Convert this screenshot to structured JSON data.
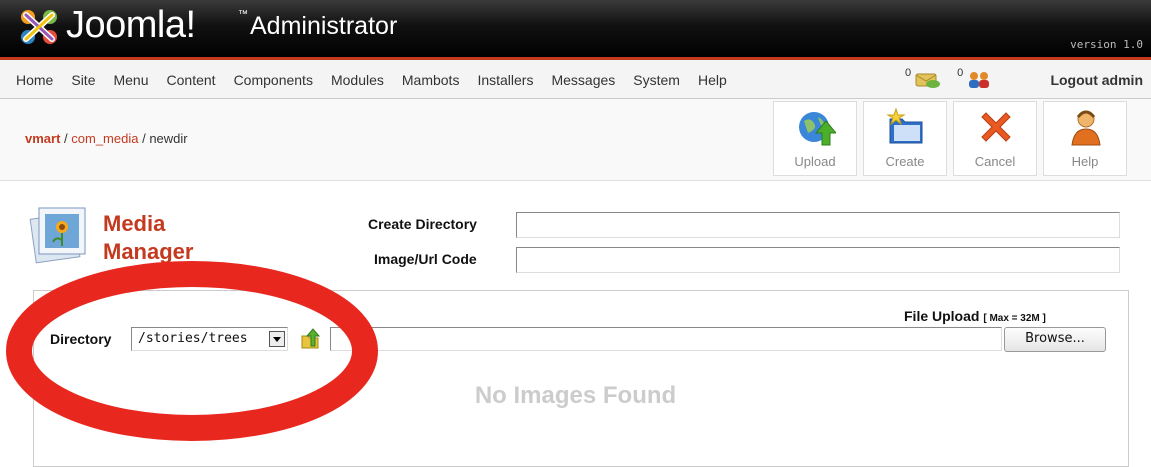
{
  "header": {
    "brand": "Joomla!",
    "tm": "™",
    "subtitle": "Administrator",
    "version": "version 1.0"
  },
  "menu": {
    "items": [
      "Home",
      "Site",
      "Menu",
      "Content",
      "Components",
      "Modules",
      "Mambots",
      "Installers",
      "Messages",
      "System",
      "Help"
    ],
    "messages_count": "0",
    "users_count": "0",
    "logout": "Logout admin"
  },
  "breadcrumb": {
    "root": "vmart",
    "sep1": " / ",
    "component": "com_media",
    "sep2": " / ",
    "current": "newdir"
  },
  "toolbar": {
    "upload": "Upload",
    "create": "Create",
    "cancel": "Cancel",
    "help": "Help"
  },
  "page": {
    "title_line1": "Media",
    "title_line2": "Manager",
    "create_dir_label": "Create Directory",
    "create_dir_value": "",
    "image_url_label": "Image/Url Code",
    "image_url_value": ""
  },
  "browser": {
    "directory_label": "Directory",
    "directory_value": "/stories/trees",
    "file_upload_label": "File Upload",
    "max_label": "[ Max = 32M ]",
    "browse_label": "Browse...",
    "empty_message": "No Images Found"
  },
  "colors": {
    "accent": "#c33a1f",
    "annotation": "#e8281f"
  }
}
